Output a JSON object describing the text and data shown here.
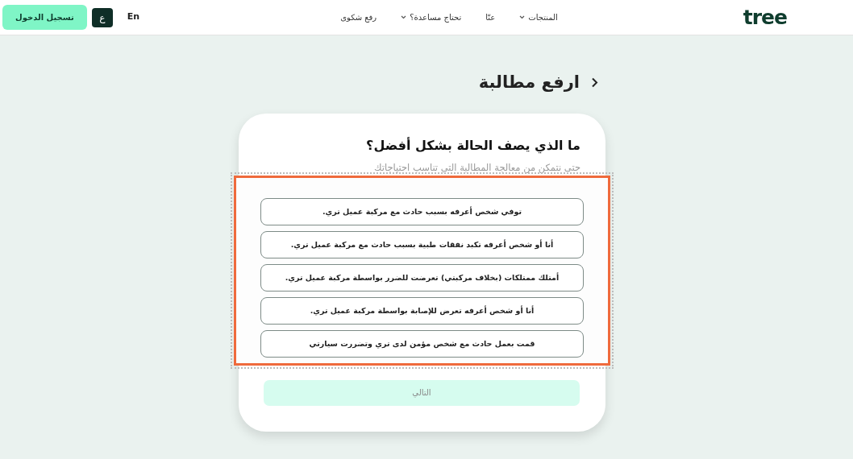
{
  "navbar": {
    "logo": "tree",
    "links": [
      {
        "label": "المنتجات",
        "dropdown": true
      },
      {
        "label": "عنّا",
        "dropdown": false
      },
      {
        "label": "تحتاج مساعدة؟",
        "dropdown": true
      },
      {
        "label": "رفع شكوى",
        "dropdown": false
      }
    ],
    "language": {
      "arabic": "ع",
      "english": "En"
    },
    "login_button": "تسجيل الدخول"
  },
  "page_title": "ارفع مطالبة",
  "card": {
    "heading": "ما الذي يصف الحالة بشكل أفضل؟",
    "subtitle": "حتى نتمكن من معالجة المطالبة التي تناسب احتياجاتك",
    "options_highlighted": true,
    "options": [
      {
        "label": "توفي شخص أعرفه بسبب حادث مع مركبة عميل تري.",
        "selected": false
      },
      {
        "label": "أنا أو شخص أعرفه تكبد نفقات طبية بسبب حادث مع مركبة عميل تري.",
        "selected": false
      },
      {
        "label": "أمتلك ممتلكات (بخلاف مركبتي) تعرضت للضرر بواسطة مركبة عميل تري.",
        "selected": false
      },
      {
        "label": "أنا أو شخص أعرفه تعرض للإصابة بواسطة مركبة عميل تري.",
        "selected": false
      },
      {
        "label": "قمت بعمل حادث مع شخص مؤمن لدى تري وتضررت سيارتي",
        "selected": false
      }
    ],
    "next_button": {
      "label": "التالي",
      "disabled": true
    }
  }
}
